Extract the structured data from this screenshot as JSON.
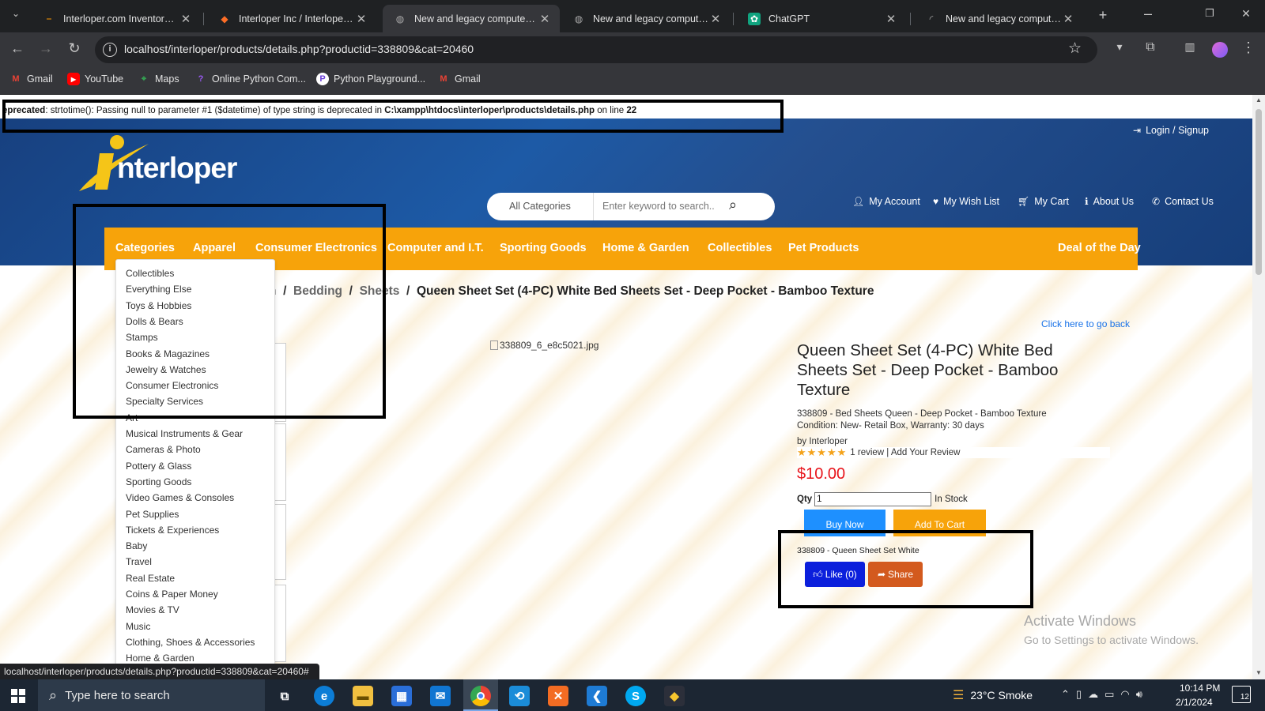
{
  "browser": {
    "tabs": [
      {
        "title": "Interloper.com Inventory Sys",
        "icon": "amazon-icon"
      },
      {
        "title": "Interloper Inc / Interloper-Liv",
        "icon": "gitlab-icon"
      },
      {
        "title": "New and legacy computers a",
        "icon": "globe-icon"
      },
      {
        "title": "New and legacy computers a",
        "icon": "globe-icon"
      },
      {
        "title": "ChatGPT",
        "icon": "chatgpt-icon"
      },
      {
        "title": "New and legacy computers a",
        "icon": "loading-icon"
      }
    ],
    "url": "localhost/interloper/products/details.php?productid=338809&cat=20460",
    "bookmarks": [
      "Gmail",
      "YouTube",
      "Maps",
      "Online Python Com...",
      "Python Playground...",
      "Gmail"
    ]
  },
  "warning": {
    "prefix": "eprecated",
    "message": ": strtotime(): Passing null to parameter #1 ($datetime) of type string is deprecated in ",
    "path": "C:\\xampp\\htdocs\\interloper\\products\\details.php",
    "mid": " on line ",
    "line": "22"
  },
  "site": {
    "logo": "nterloper",
    "login": "Login / Signup",
    "search": {
      "category": "All Categories",
      "placeholder": "Enter keyword to search.."
    },
    "header_links": [
      "My Account",
      "My Wish List",
      "My Cart",
      "About Us",
      "Contact Us"
    ],
    "nav": [
      "Categories",
      "Apparel",
      "Consumer Electronics",
      "Computer and I.T.",
      "Sporting Goods",
      "Home & Garden",
      "Collectibles",
      "Pet Products"
    ],
    "deal": "Deal of the Day"
  },
  "categories_dropdown": [
    "Collectibles",
    "Everything Else",
    "Toys & Hobbies",
    "Dolls & Bears",
    "Stamps",
    "Books & Magazines",
    "Jewelry & Watches",
    "Consumer Electronics",
    "Specialty Services",
    "Art",
    "Musical Instruments & Gear",
    "Cameras & Photo",
    "Pottery & Glass",
    "Sporting Goods",
    "Video Games & Consoles",
    "Pet Supplies",
    "Tickets & Experiences",
    "Baby",
    "Travel",
    "Real Estate",
    "Coins & Paper Money",
    "Movies & TV",
    "Music",
    "Clothing, Shoes & Accessories",
    "Home & Garden"
  ],
  "breadcrumb": {
    "partial": "n",
    "items": [
      "Bedding",
      "Sheets"
    ],
    "current": "Queen Sheet Set (4-PC) White Bed Sheets Set - Deep Pocket - Bamboo Texture"
  },
  "product": {
    "go_back": "Click here to go back",
    "image_alt": "338809_6_e8c5021.jpg",
    "title": "Queen Sheet Set (4-PC) White Bed Sheets Set - Deep Pocket - Bamboo Texture",
    "desc": "338809 - Bed Sheets Queen - Deep Pocket - Bamboo Texture",
    "condition": "Condition: New- Retail Box, Warranty: 30 days",
    "by": "by Interloper",
    "rating": 5,
    "reviews": "1 review | Add Your Review",
    "price": "$10.00",
    "qty_label": "Qty",
    "qty": "1",
    "stock": "In Stock",
    "buy": "Buy Now",
    "cart": "Add To Cart",
    "sku_line": "338809 - Queen Sheet Set White",
    "like": "Like (0)",
    "share": "Share"
  },
  "status_url": "localhost/interloper/products/details.php?productid=338809&cat=20460#",
  "watermark": {
    "title": "Activate Windows",
    "sub": "Go to Settings to activate Windows."
  },
  "taskbar": {
    "search": "Type here to search",
    "weather": "23°C  Smoke",
    "time": "10:14 PM",
    "date": "2/1/2024",
    "notifications": "12"
  },
  "colors": {
    "nav": "#f7a30a",
    "price": "#e8141b",
    "buy": "#1e90ff",
    "like": "#0b1fdc",
    "share": "#d35a1e"
  }
}
